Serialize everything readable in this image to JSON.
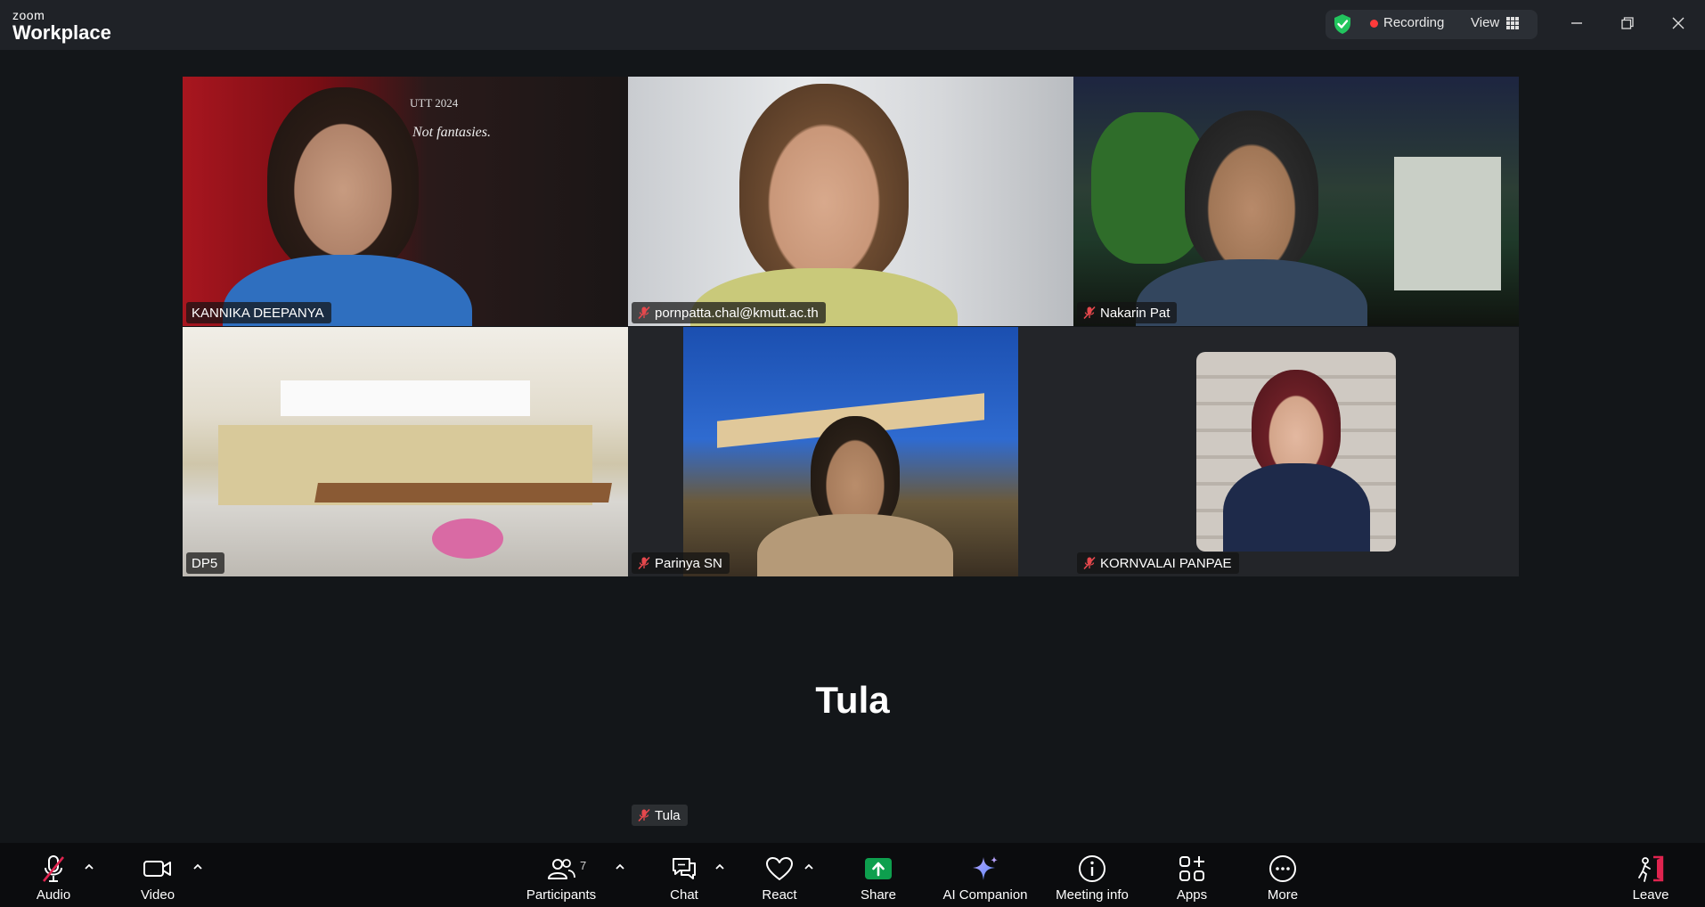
{
  "app": {
    "brand_small": "zoom",
    "brand_large": "Workplace"
  },
  "titlebar": {
    "recording_label": "Recording",
    "view_label": "View"
  },
  "participants": [
    {
      "name": "KANNIKA DEEPANYA",
      "muted": false,
      "active": false,
      "poster_text_1": "UTT 2024",
      "poster_text_2": "Not fantasies."
    },
    {
      "name": "pornpatta.chal@kmutt.ac.th",
      "muted": true,
      "active": false
    },
    {
      "name": "Nakarin Pat",
      "muted": true,
      "active": false
    },
    {
      "name": "DP5",
      "muted": false,
      "active": true
    },
    {
      "name": "Parinya SN",
      "muted": true,
      "active": false
    },
    {
      "name": "KORNVALAI PANPAE",
      "muted": true,
      "active": false
    }
  ],
  "no_video_participant": {
    "name": "Tula",
    "muted": true
  },
  "toolbar": {
    "audio": "Audio",
    "video": "Video",
    "participants": "Participants",
    "participants_count": "7",
    "chat": "Chat",
    "react": "React",
    "share": "Share",
    "ai_companion": "AI Companion",
    "meeting_info": "Meeting info",
    "apps": "Apps",
    "more": "More",
    "leave": "Leave"
  },
  "colors": {
    "accent_green": "#22c55e",
    "share_green": "#0e9f4e",
    "leave_red": "#e0244f",
    "muted_red": "#e5484d"
  }
}
